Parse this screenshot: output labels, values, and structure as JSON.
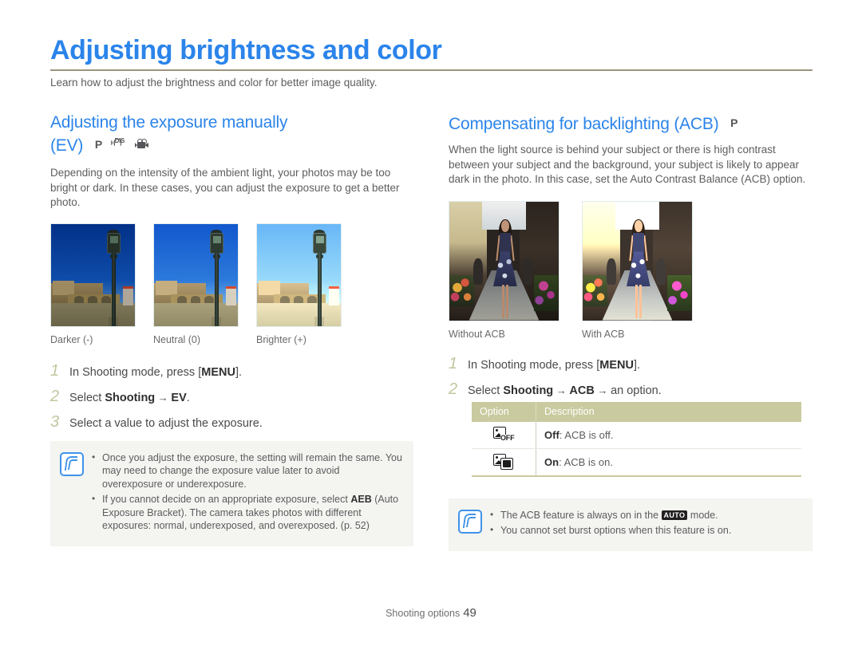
{
  "document": {
    "title": "Adjusting brightness and color",
    "lead": "Learn how to adjust the brightness and color for better image quality.",
    "accent_color": "#2b84ea",
    "rule_color": "#9b947f",
    "footer": {
      "label": "Shooting options",
      "page_number": "49"
    }
  },
  "left_section": {
    "heading_line1": "Adjusting the exposure manually",
    "heading_line2": "(EV)",
    "mode_icons": [
      "p-mode-icon",
      "dis-mode-icon",
      "movie-mode-icon"
    ],
    "mode_icon_labels": {
      "p": "P",
      "dis": "DIS"
    },
    "body": "Depending on the intensity of the ambient light, your photos may be too bright or dark. In these cases, you can adjust the exposure to get a better photo.",
    "figures": [
      {
        "caption": "Darker (-)",
        "brightness": 0.78
      },
      {
        "caption": "Neutral (0)",
        "brightness": 1.0
      },
      {
        "caption": "Brighter (+)",
        "brightness": 1.3
      }
    ],
    "steps": [
      {
        "num": "1",
        "pre": "In Shooting mode, press [",
        "kbd": "MENU",
        "post": "]."
      },
      {
        "num": "2",
        "pre": "Select ",
        "b1": "Shooting",
        "arrow": " → ",
        "b2": "EV",
        "post": "."
      },
      {
        "num": "3",
        "pre": "Select a value to adjust the exposure.",
        "kbd": "",
        "post": ""
      }
    ],
    "note": {
      "icon": "note-pen-icon",
      "bullets": [
        "Once you adjust the exposure, the setting will remain the same. You may need to change the exposure value later to avoid overexposure or underexposure.",
        "If you cannot decide on an appropriate exposure, select AEB (Auto Exposure Bracket). The camera takes photos with different exposures: normal, underexposed, and overexposed. (p. 52)"
      ],
      "bullet2_parts": {
        "pre": "If you cannot decide on an appropriate exposure, select ",
        "bold": "AEB",
        "post": " (Auto Exposure Bracket). The camera takes photos with different exposures: normal, underexposed, and overexposed. (p. 52)"
      }
    }
  },
  "right_section": {
    "heading": "Compensating for backlighting (ACB)",
    "mode_icons": [
      "p-mode-icon"
    ],
    "mode_icon_labels": {
      "p": "P"
    },
    "body": "When the light source is behind your subject or there is high contrast between your subject and the background, your subject is likely to appear dark in the photo. In this case, set the Auto Contrast Balance (ACB) option.",
    "figures": [
      {
        "caption": "Without ACB",
        "brightness": 1.0
      },
      {
        "caption": "With ACB",
        "brightness": 1.42
      }
    ],
    "steps": [
      {
        "num": "1",
        "pre": "In Shooting mode, press [",
        "kbd": "MENU",
        "post": "]."
      },
      {
        "num": "2",
        "pre": "Select ",
        "b1": "Shooting",
        "arrow": " → ",
        "b2": "ACB",
        "arrow2": " → ",
        "post": "an option."
      }
    ],
    "table": {
      "header_color": "#c9ca9f",
      "columns": [
        "Option",
        "Description"
      ],
      "rows": [
        {
          "icon": "acb-off-icon",
          "label": "Off",
          "desc": ": ACB is off."
        },
        {
          "icon": "acb-on-icon",
          "label": "On",
          "desc": ": ACB is on."
        }
      ]
    },
    "note": {
      "icon": "note-pen-icon",
      "bullet1_parts": {
        "pre": "The ACB feature is always on in the ",
        "badge": "AUTO",
        "post": " mode."
      },
      "bullet2": "You cannot set burst options when this feature is on."
    }
  }
}
